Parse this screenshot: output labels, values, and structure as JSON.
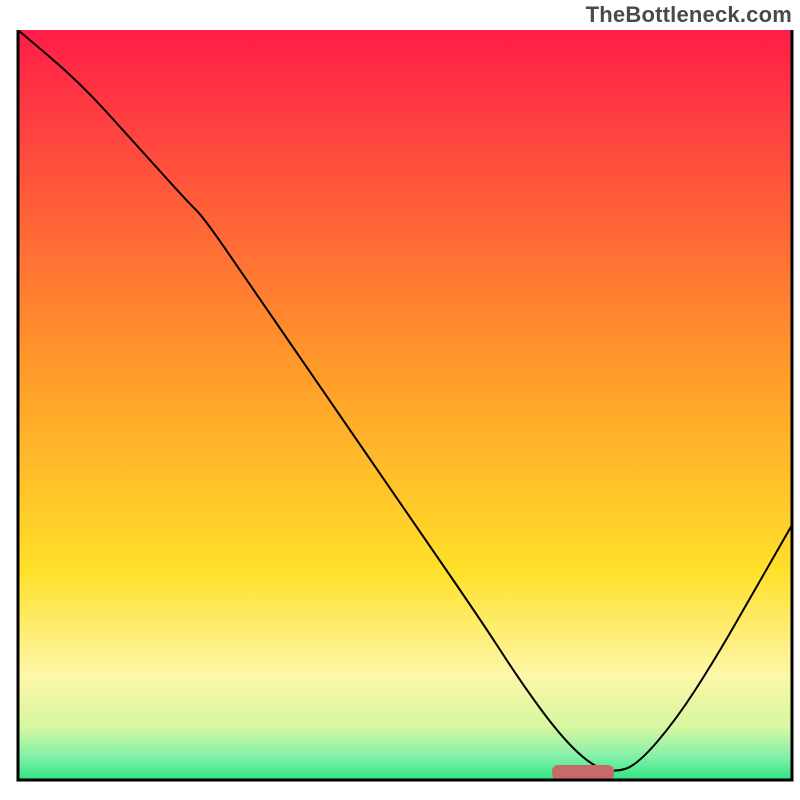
{
  "watermark": "TheBottleneck.com",
  "chart_data": {
    "type": "line",
    "title": "",
    "xlabel": "",
    "ylabel": "",
    "xlim": [
      0,
      100
    ],
    "ylim": [
      0,
      100
    ],
    "grid": false,
    "legend": false,
    "background_gradient": {
      "stops": [
        {
          "offset": 0.0,
          "color": "#ff1d49"
        },
        {
          "offset": 0.45,
          "color": "#ff9a2a"
        },
        {
          "offset": 0.72,
          "color": "#ffe029"
        },
        {
          "offset": 0.86,
          "color": "#fdf7a8"
        },
        {
          "offset": 0.93,
          "color": "#d6f7a0"
        },
        {
          "offset": 0.97,
          "color": "#7ff0a9"
        },
        {
          "offset": 1.0,
          "color": "#2de47f"
        }
      ]
    },
    "series": [
      {
        "name": "bottleneck-curve",
        "color": "#000000",
        "stroke_width": 2,
        "x": [
          0,
          8,
          15,
          22,
          24,
          30,
          40,
          50,
          60,
          65,
          70,
          74,
          77,
          80,
          85,
          90,
          95,
          100
        ],
        "y": [
          100,
          93,
          85,
          77,
          75,
          66,
          51,
          36,
          21,
          13,
          6,
          2,
          1,
          2,
          8,
          16,
          25,
          34
        ]
      }
    ],
    "marker": {
      "name": "highlight-pill",
      "color": "#c96a6a",
      "x_center": 73,
      "width": 8,
      "y": 1,
      "height": 2
    },
    "axes": {
      "frame_color": "#000000",
      "frame_width": 3
    }
  }
}
